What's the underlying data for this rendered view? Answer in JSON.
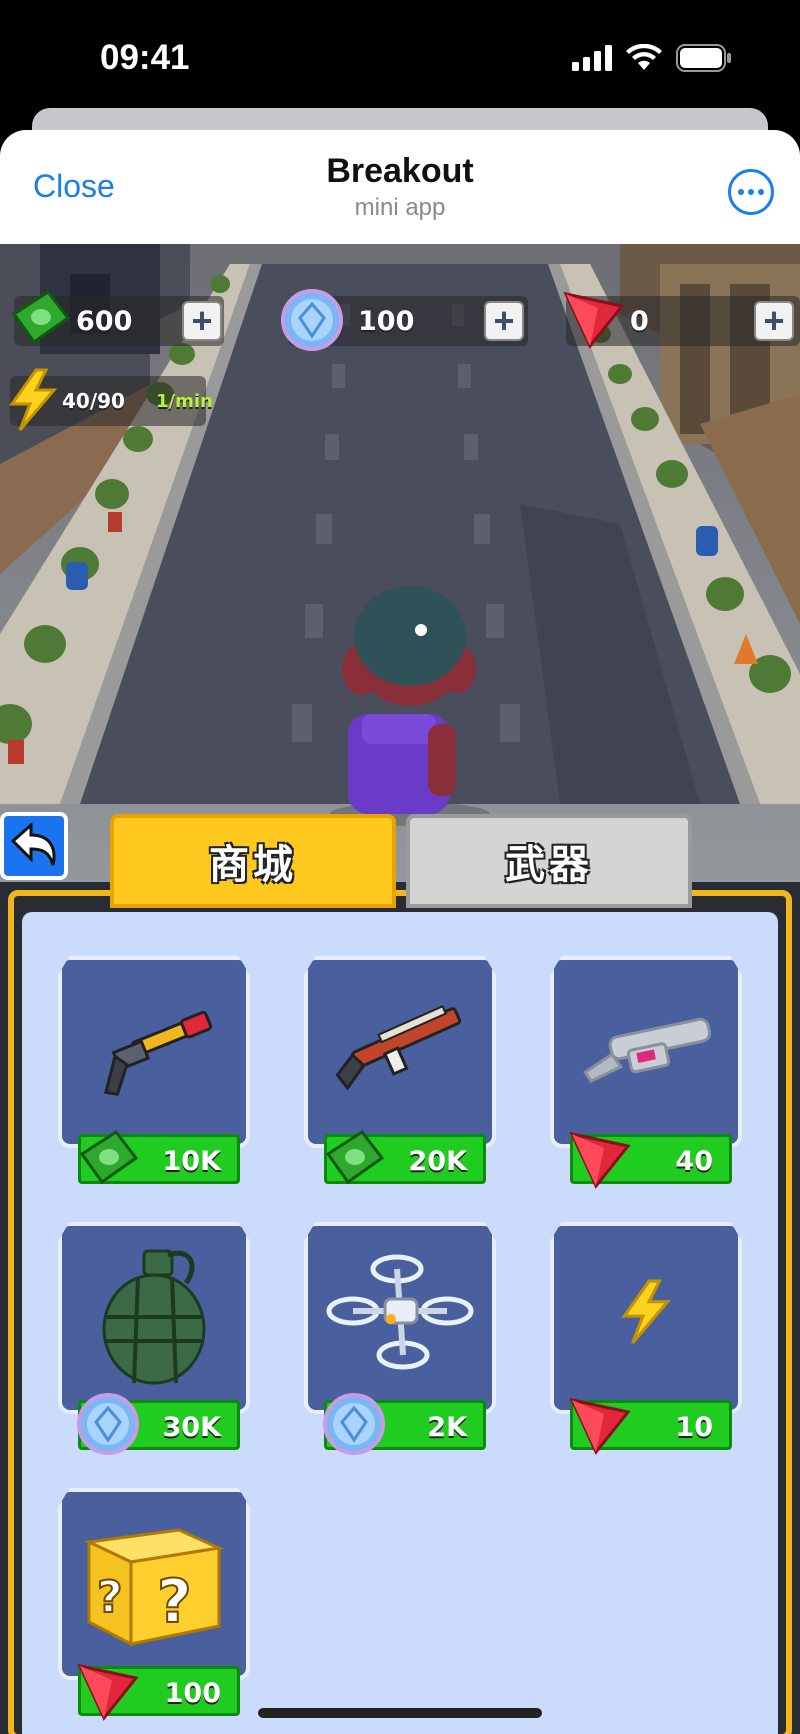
{
  "status_bar": {
    "time": "09:41"
  },
  "header": {
    "close_label": "Close",
    "title": "Breakout",
    "subtitle": "mini app"
  },
  "resources": {
    "cash": "600",
    "gems": "100",
    "rubies": "0",
    "energy": "40/90",
    "energy_rate": "1/min"
  },
  "tabs": {
    "shop": "商城",
    "weapons": "武器"
  },
  "shop_items": [
    {
      "item_icon": "shotgun-icon",
      "currency_icon": "cash-icon",
      "price": "10K"
    },
    {
      "item_icon": "rifle-icon",
      "currency_icon": "cash-icon",
      "price": "20K"
    },
    {
      "item_icon": "blaster-icon",
      "currency_icon": "ruby-icon",
      "price": "40"
    },
    {
      "item_icon": "grenade-icon",
      "currency_icon": "gem-icon",
      "price": "30K"
    },
    {
      "item_icon": "drone-icon",
      "currency_icon": "gem-icon",
      "price": "2K"
    },
    {
      "item_icon": "lightning-icon",
      "currency_icon": "ruby-icon",
      "price": "10"
    },
    {
      "item_icon": "mystery-box-icon",
      "currency_icon": "ruby-icon",
      "price": "100"
    }
  ],
  "colors": {
    "accent_blue": "#1a7ef0",
    "tab_active": "#ffc81f",
    "price_green": "#1fcc1f",
    "panel_bg": "#cbdbfb",
    "card_bg": "#4a5f9e"
  }
}
